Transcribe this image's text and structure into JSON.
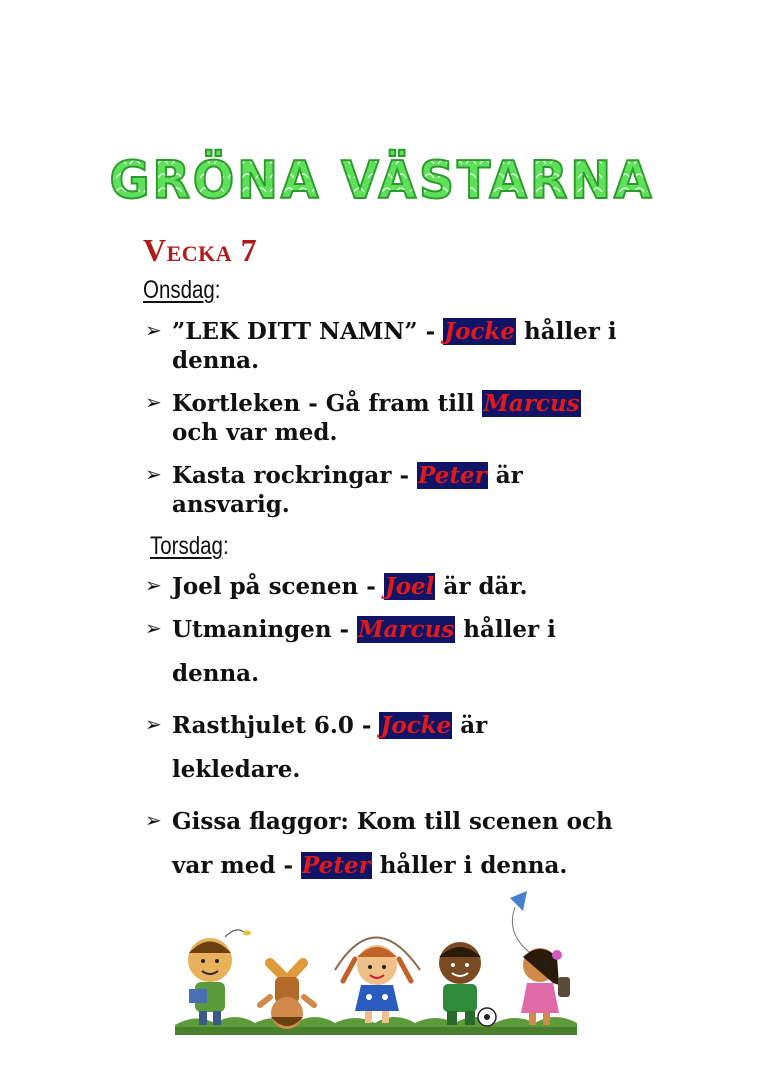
{
  "title": "GRÖNA VÄSTARNA",
  "week": "Vecka 7",
  "days": [
    {
      "label": "Onsdag",
      "suffix": ":",
      "items": [
        {
          "pre": "”LEK DITT NAMN” - ",
          "name": "Jocke",
          "post": " håller i",
          "line2": "denna."
        },
        {
          "pre": "Kortleken - Gå fram till ",
          "name": "Marcus",
          "post": "",
          "line2": "och var med."
        },
        {
          "pre": "Kasta rockringar - ",
          "name": "Peter",
          "post": " är",
          "line2": "ansvarig."
        }
      ]
    },
    {
      "label": "Torsdag",
      "suffix": ":",
      "items": [
        {
          "pre": "Joel på scenen - ",
          "name": "Joel",
          "post": " är där.",
          "line2": ""
        },
        {
          "pre": "Utmaningen - ",
          "name": "Marcus",
          "post": " håller i",
          "line2": "denna."
        },
        {
          "pre": "Rasthjulet 6.0 - ",
          "name": "Jocke",
          "post": " är",
          "line2": "lekledare."
        },
        {
          "pre": "Gissa flaggor: Kom till scenen och",
          "name": "",
          "post": "",
          "line2_pre": "var med - ",
          "line2_name": "Peter",
          "line2_post": " håller i denna."
        }
      ]
    }
  ],
  "colors": {
    "title_green": "#4fd64a",
    "title_outline": "#2a9b2a",
    "week_red": "#b01c1c",
    "name_bg": "#0f1466",
    "name_fg": "#e01a1a"
  },
  "icons": {
    "bullet": "arrowhead-bullet-icon",
    "illustration": "children-playing-illustration"
  }
}
